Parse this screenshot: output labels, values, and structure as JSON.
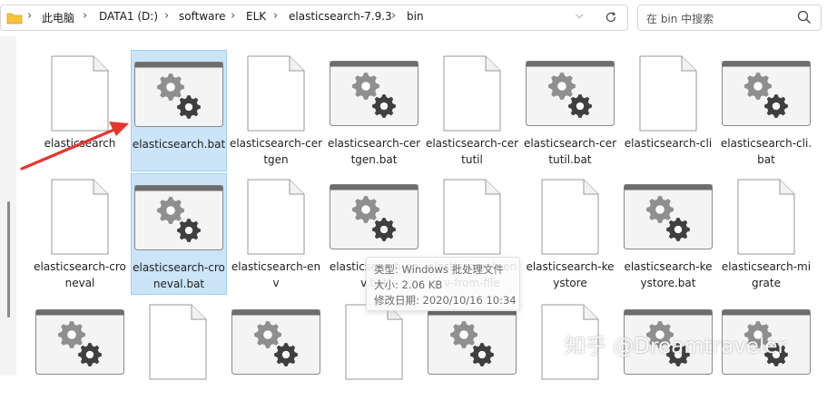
{
  "address_bar": {
    "crumbs": [
      "此电脑",
      "DATA1 (D:)",
      "software",
      "ELK",
      "elasticsearch-7.9.3",
      "bin"
    ],
    "separator": ">"
  },
  "search": {
    "placeholder": "在 bin 中搜索"
  },
  "files": [
    {
      "name": "elasticsearch",
      "type": "doc",
      "selected": false
    },
    {
      "name": "elasticsearch.bat",
      "type": "bat",
      "selected": true
    },
    {
      "name": "elasticsearch-certgen",
      "type": "doc",
      "selected": false
    },
    {
      "name": "elasticsearch-certgen.bat",
      "type": "bat",
      "selected": false
    },
    {
      "name": "elasticsearch-certutil",
      "type": "doc",
      "selected": false
    },
    {
      "name": "elasticsearch-certutil.bat",
      "type": "bat",
      "selected": false
    },
    {
      "name": "elasticsearch-cli",
      "type": "doc",
      "selected": false
    },
    {
      "name": "elasticsearch-cli.bat",
      "type": "bat",
      "selected": false
    },
    {
      "name": "elasticsearch-croneval",
      "type": "doc",
      "selected": false
    },
    {
      "name": "elasticsearch-croneval.bat",
      "type": "bat",
      "selected": true
    },
    {
      "name": "elasticsearch-env",
      "type": "doc",
      "selected": false
    },
    {
      "name": "elasticsearch-env.bat",
      "type": "bat",
      "selected": false
    },
    {
      "name": "elasticsearch-env-from-file",
      "type": "doc",
      "selected": false
    },
    {
      "name": "elasticsearch-keystore",
      "type": "doc",
      "selected": false
    },
    {
      "name": "elasticsearch-keystore.bat",
      "type": "bat",
      "selected": false
    },
    {
      "name": "elasticsearch-migrate",
      "type": "doc",
      "selected": false
    },
    {
      "name": "",
      "type": "bat",
      "selected": false
    },
    {
      "name": "",
      "type": "doc",
      "selected": false
    },
    {
      "name": "",
      "type": "bat",
      "selected": false
    },
    {
      "name": "",
      "type": "doc",
      "selected": false
    },
    {
      "name": "",
      "type": "bat",
      "selected": false
    },
    {
      "name": "",
      "type": "doc",
      "selected": false
    },
    {
      "name": "",
      "type": "bat",
      "selected": false
    },
    {
      "name": "",
      "type": "bat",
      "selected": false
    }
  ],
  "tooltip": {
    "type_line": "类型: Windows 批处理文件",
    "size_line": "大小: 2.06 KB",
    "date_line": "修改日期: 2020/10/16 10:34"
  },
  "watermark": "知乎 @Dreamtraveler",
  "colors": {
    "selection_bg": "#cce4f7",
    "selection_border": "#99d1ff",
    "folder_yellow": "#f8c33a",
    "arrow_red": "#e8352e"
  }
}
